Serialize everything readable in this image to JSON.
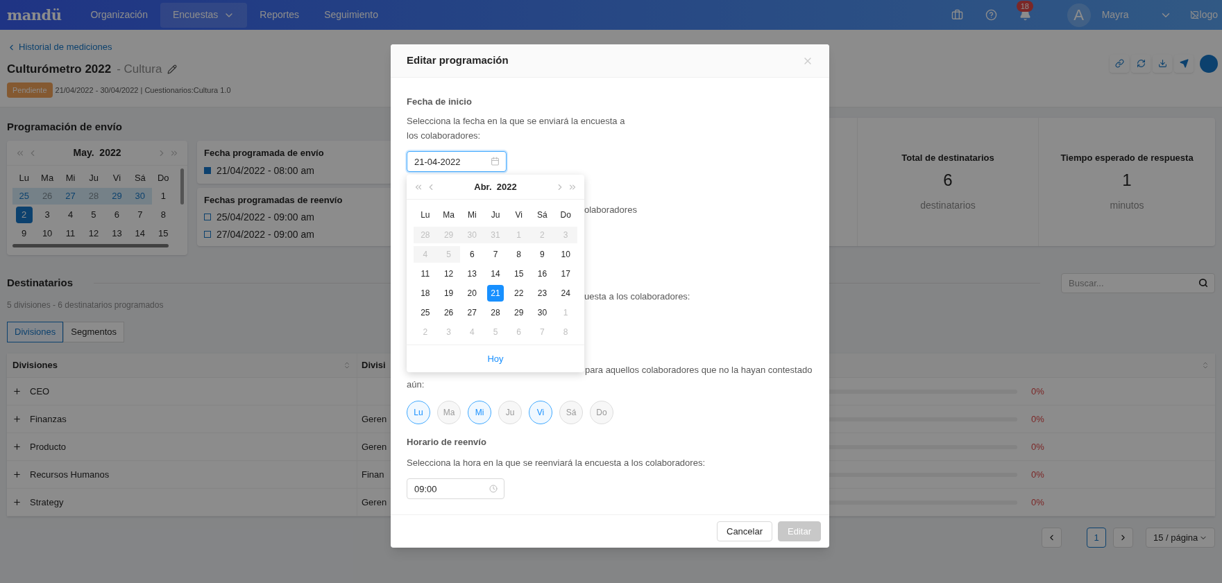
{
  "header": {
    "logo": "mandü",
    "nav": [
      {
        "label": "Organización",
        "selected": false,
        "has_menu": false
      },
      {
        "label": "Encuestas",
        "selected": true,
        "has_menu": true
      },
      {
        "label": "Reportes",
        "selected": false,
        "has_menu": false
      },
      {
        "label": "Seguimiento",
        "selected": false,
        "has_menu": false
      }
    ],
    "notifications": "18",
    "avatar": "A",
    "user": "Mayra",
    "logo_alt": "logo"
  },
  "page": {
    "back_link": "Historial de mediciones",
    "title": "Culturómetro 2022",
    "subtitle": "- Cultura",
    "status": "Pendiente",
    "meta": "21/04/2022 - 30/04/2022 | Cuestionarios:Cultura 1.0"
  },
  "schedule": {
    "title": "Programación de envío",
    "calendar": {
      "month": "May.",
      "year": "2022",
      "weekdays": [
        "Lu",
        "Ma",
        "Mi",
        "Ju",
        "Vi",
        "Sá",
        "Do"
      ],
      "weeks": [
        [
          {
            "label": "25",
            "kind": "scheduled",
            "selected": false
          },
          {
            "label": "26",
            "kind": "muted",
            "selected": false
          },
          {
            "label": "27",
            "kind": "scheduled",
            "selected": false
          },
          {
            "label": "28",
            "kind": "muted",
            "selected": false
          },
          {
            "label": "29",
            "kind": "scheduled",
            "selected": false
          },
          {
            "label": "30",
            "kind": "scheduled",
            "selected": false
          },
          {
            "label": "1",
            "kind": "day",
            "selected": false
          }
        ],
        [
          {
            "label": "2",
            "kind": "day",
            "selected": true
          },
          {
            "label": "3",
            "kind": "day",
            "selected": false
          },
          {
            "label": "4",
            "kind": "day",
            "selected": false
          },
          {
            "label": "5",
            "kind": "day",
            "selected": false
          },
          {
            "label": "6",
            "kind": "day",
            "selected": false
          },
          {
            "label": "7",
            "kind": "day",
            "selected": false
          },
          {
            "label": "8",
            "kind": "day",
            "selected": false
          }
        ],
        [
          {
            "label": "9",
            "kind": "day",
            "selected": false
          },
          {
            "label": "10",
            "kind": "day",
            "selected": false
          },
          {
            "label": "11",
            "kind": "day",
            "selected": false
          },
          {
            "label": "12",
            "kind": "day",
            "selected": false
          },
          {
            "label": "13",
            "kind": "day",
            "selected": false
          },
          {
            "label": "14",
            "kind": "day",
            "selected": false
          },
          {
            "label": "15",
            "kind": "day",
            "selected": false
          }
        ]
      ]
    },
    "send": {
      "title": "Fecha programada de envío",
      "dates": [
        {
          "label": "21/04/2022 - 08:00 am",
          "kind": "send"
        }
      ]
    },
    "resend": {
      "title": "Fechas programadas de reenvío",
      "dates": [
        {
          "label": "25/04/2022 - 09:00 am",
          "kind": "resend"
        },
        {
          "label": "27/04/2022 - 09:00 am",
          "kind": "resend"
        }
      ]
    }
  },
  "stats": [
    {
      "title": "Total de destinatarios",
      "value": "6",
      "unit": "destinatarios"
    },
    {
      "title": "Tiempo esperado de respuesta",
      "value": "1",
      "unit": "minutos"
    }
  ],
  "recipients": {
    "title": "Destinatarios",
    "summary": "5 divisiones - 6 destinatarios programados",
    "tabs": [
      {
        "label": "Divisiones",
        "selected": true
      },
      {
        "label": "Segmentos",
        "selected": false
      }
    ],
    "search": {
      "placeholder": "Buscar..."
    },
    "table": {
      "columns": [
        "Divisiones",
        "Divisi"
      ],
      "rows": [
        {
          "division": "CEO",
          "level": 0,
          "percent": "0%"
        },
        {
          "division": "Finanzas",
          "column_2": "Geren",
          "level": 0,
          "percent": "0%"
        },
        {
          "division": "Producto",
          "column_2": "Geren",
          "level": 0,
          "percent": "0%"
        },
        {
          "division": "Recursos Humanos",
          "column_2": "Finan",
          "level": 0,
          "percent": "0%"
        },
        {
          "division": "Strategy",
          "column_2": "Geren",
          "level": 0,
          "percent": "0%"
        }
      ]
    },
    "pagination": {
      "pages": [
        {
          "label": "1",
          "selected": true
        }
      ],
      "page_size": "15 / página"
    }
  },
  "modal": {
    "title": "Editar programación",
    "start": {
      "heading": "Fecha de inicio",
      "description": "Selecciona la fecha en la que se enviará la encuesta a los colaboradores:",
      "value": "21-04-2022"
    },
    "datepicker": {
      "month": "Abr.",
      "year": "2022",
      "weekdays": [
        "Lu",
        "Ma",
        "Mi",
        "Ju",
        "Vi",
        "Sá",
        "Do"
      ],
      "today": "Hoy",
      "weeks": [
        [
          {
            "label": "28",
            "kind": "disabled",
            "selected": false
          },
          {
            "label": "29",
            "kind": "disabled",
            "selected": false
          },
          {
            "label": "30",
            "kind": "disabled",
            "selected": false
          },
          {
            "label": "31",
            "kind": "disabled",
            "selected": false
          },
          {
            "label": "1",
            "kind": "disabled",
            "selected": false
          },
          {
            "label": "2",
            "kind": "disabled",
            "selected": false
          },
          {
            "label": "3",
            "kind": "disabled",
            "selected": false
          }
        ],
        [
          {
            "label": "4",
            "kind": "disabled",
            "selected": false
          },
          {
            "label": "5",
            "kind": "disabled",
            "selected": false
          },
          {
            "label": "6",
            "kind": "day",
            "selected": false
          },
          {
            "label": "7",
            "kind": "day",
            "selected": false
          },
          {
            "label": "8",
            "kind": "day",
            "selected": false
          },
          {
            "label": "9",
            "kind": "day",
            "selected": false
          },
          {
            "label": "10",
            "kind": "day",
            "selected": false
          }
        ],
        [
          {
            "label": "11",
            "kind": "day",
            "selected": false
          },
          {
            "label": "12",
            "kind": "day",
            "selected": false
          },
          {
            "label": "13",
            "kind": "day",
            "selected": false
          },
          {
            "label": "14",
            "kind": "day",
            "selected": false
          },
          {
            "label": "15",
            "kind": "day",
            "selected": false
          },
          {
            "label": "16",
            "kind": "day",
            "selected": false
          },
          {
            "label": "17",
            "kind": "day",
            "selected": false
          }
        ],
        [
          {
            "label": "18",
            "kind": "day",
            "selected": false
          },
          {
            "label": "19",
            "kind": "day",
            "selected": false
          },
          {
            "label": "20",
            "kind": "day",
            "selected": false
          },
          {
            "label": "21",
            "kind": "day",
            "selected": true
          },
          {
            "label": "22",
            "kind": "day",
            "selected": false
          },
          {
            "label": "23",
            "kind": "day",
            "selected": false
          },
          {
            "label": "24",
            "kind": "day",
            "selected": false
          }
        ],
        [
          {
            "label": "25",
            "kind": "day",
            "selected": false
          },
          {
            "label": "26",
            "kind": "day",
            "selected": false
          },
          {
            "label": "27",
            "kind": "day",
            "selected": false
          },
          {
            "label": "28",
            "kind": "day",
            "selected": false
          },
          {
            "label": "29",
            "kind": "day",
            "selected": false
          },
          {
            "label": "30",
            "kind": "day",
            "selected": false
          },
          {
            "label": "1",
            "kind": "outside",
            "selected": false
          }
        ],
        [
          {
            "label": "2",
            "kind": "outside",
            "selected": false
          },
          {
            "label": "3",
            "kind": "outside",
            "selected": false
          },
          {
            "label": "4",
            "kind": "outside",
            "selected": false
          },
          {
            "label": "5",
            "kind": "outside",
            "selected": false
          },
          {
            "label": "6",
            "kind": "outside",
            "selected": false
          },
          {
            "label": "7",
            "kind": "outside",
            "selected": false
          },
          {
            "label": "8",
            "kind": "outside",
            "selected": false
          }
        ]
      ]
    },
    "hidden_fragments": [
      "olaboradores",
      "uesta a los colaboradores:"
    ],
    "resend_days": {
      "text_fragment": "para aquellos colaboradores que no la hayan contestado",
      "text_end": "aún:",
      "days": [
        {
          "label": "Lu",
          "selected": true
        },
        {
          "label": "Ma",
          "selected": false
        },
        {
          "label": "Mi",
          "selected": true
        },
        {
          "label": "Ju",
          "selected": false
        },
        {
          "label": "Vi",
          "selected": true
        },
        {
          "label": "Sá",
          "selected": false
        },
        {
          "label": "Do",
          "selected": false
        }
      ]
    },
    "resend_time": {
      "heading": "Horario de reenvío",
      "description": "Selecciona la hora en la que se reenviará la encuesta a los colaboradores:",
      "value": "09:00"
    },
    "buttons": [
      {
        "label": "Cancelar",
        "kind": "default",
        "disabled": false
      },
      {
        "label": "Editar",
        "kind": "primary",
        "disabled": true
      }
    ]
  }
}
